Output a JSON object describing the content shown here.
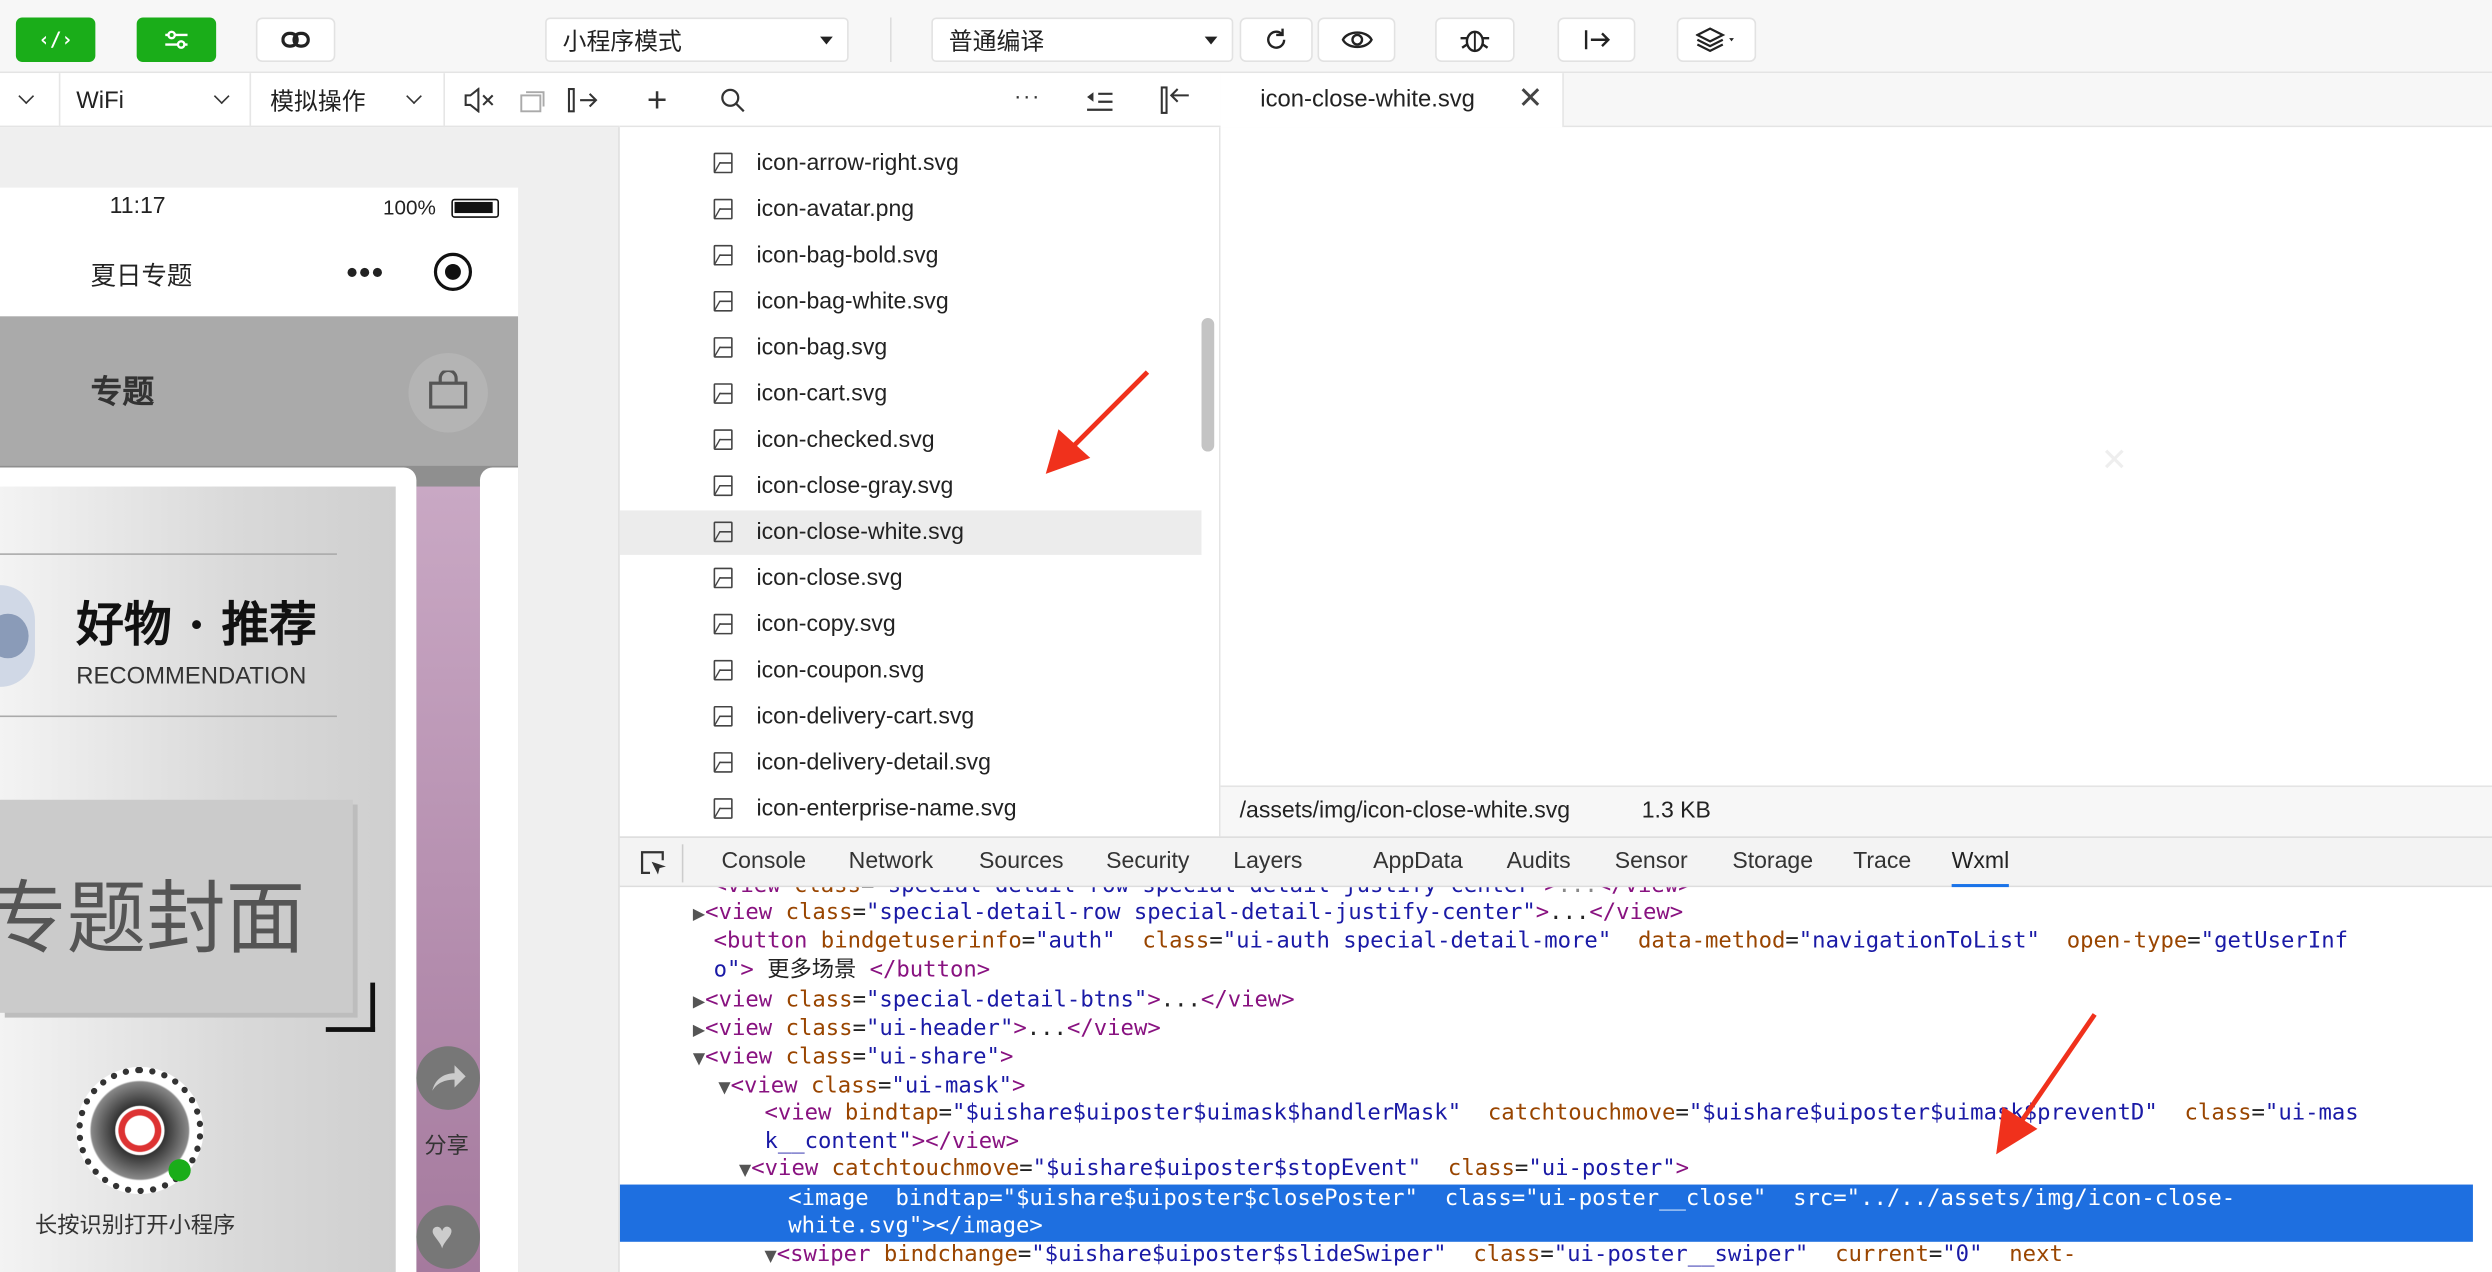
{
  "toolbar": {
    "mode_select": "小程序模式",
    "compile_select": "普通编译",
    "code_icon": "code-icon",
    "compile_icon": "refresh-icon",
    "preview_icon": "eye-icon",
    "debug_icon": "bug-icon",
    "upload_icon": "upload-icon",
    "version_icon": "layers-icon"
  },
  "sim_bar": {
    "network": "WiFi",
    "operation": "模拟操作"
  },
  "phone": {
    "time": "11:17",
    "battery": "100%",
    "nav_title": "夏日专题",
    "header_title": "专题",
    "brand_title": "好物 · 推荐",
    "brand_sub": "RECOMMENDATION",
    "cover_text": "专题封面",
    "share_label": "分享",
    "qr_caption": "长按识别打开小程序"
  },
  "filetree": {
    "files": [
      "icon-arrow-right.svg",
      "icon-avatar.png",
      "icon-bag-bold.svg",
      "icon-bag-white.svg",
      "icon-bag.svg",
      "icon-cart.svg",
      "icon-checked.svg",
      "icon-close-gray.svg",
      "icon-close-white.svg",
      "icon-close.svg",
      "icon-copy.svg",
      "icon-coupon.svg",
      "icon-delivery-cart.svg",
      "icon-delivery-detail.svg",
      "icon-enterprise-name.svg"
    ],
    "selected": "icon-close-white.svg"
  },
  "editor": {
    "tab": "icon-close-white.svg",
    "status_path": "/assets/img/icon-close-white.svg",
    "status_size": "1.3 KB"
  },
  "devtools": {
    "tabs": [
      "Console",
      "Network",
      "Sources",
      "Security",
      "Layers",
      "AppData",
      "Audits",
      "Sensor",
      "Storage",
      "Trace",
      "Wxml"
    ],
    "active_tab": "Wxml"
  },
  "colors": {
    "brand_green": "#1aad19",
    "selection_blue": "#1e6fe0",
    "annotation_red": "#f0311c"
  }
}
